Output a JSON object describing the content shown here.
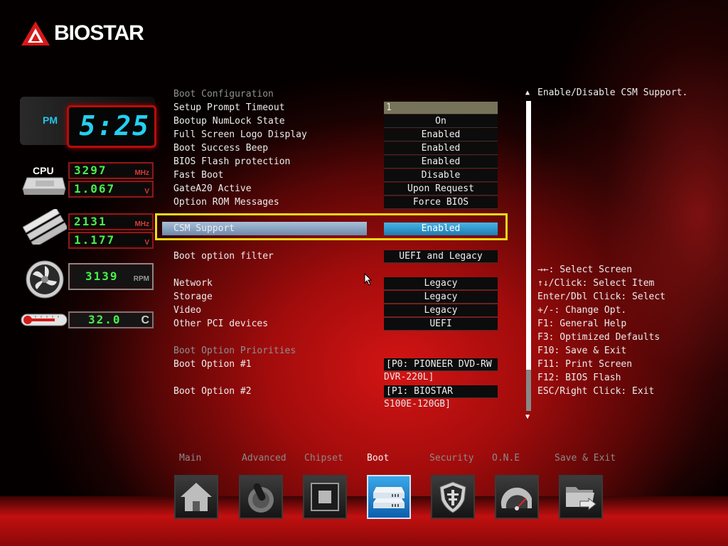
{
  "brand": {
    "name": "BIOSTAR"
  },
  "clock": {
    "ampm": "PM",
    "time": "5:25"
  },
  "sensors": {
    "cpu_label": "CPU",
    "cpu_freq": {
      "value": "3297",
      "unit": "MHz"
    },
    "cpu_volt": {
      "value": "1.067",
      "unit": "V"
    },
    "mem_freq": {
      "value": "2131",
      "unit": "MHz"
    },
    "mem_volt": {
      "value": "1.177",
      "unit": "V"
    },
    "fan": {
      "value": "3139",
      "unit": "RPM"
    },
    "temp": {
      "value": "32.0",
      "unit": "C"
    }
  },
  "options": {
    "boot_config_header": "Boot Configuration",
    "setup_prompt_timeout": {
      "label": "Setup Prompt Timeout",
      "value": "1"
    },
    "numlock": {
      "label": "Bootup NumLock State",
      "value": "On"
    },
    "logo": {
      "label": "Full Screen Logo Display",
      "value": "Enabled"
    },
    "beep": {
      "label": "Boot Success Beep",
      "value": "Enabled"
    },
    "flash_protect": {
      "label": "BIOS Flash protection",
      "value": "Enabled"
    },
    "fast_boot": {
      "label": "Fast Boot",
      "value": "Disable"
    },
    "gatea20": {
      "label": "GateA20 Active",
      "value": "Upon Request"
    },
    "option_rom": {
      "label": "Option ROM Messages",
      "value": "Force BIOS"
    },
    "csm": {
      "label": "CSM Support",
      "value": "Enabled"
    },
    "boot_filter": {
      "label": "Boot option filter",
      "value": "UEFI and Legacy"
    },
    "network": {
      "label": "Network",
      "value": "Legacy"
    },
    "storage": {
      "label": "Storage",
      "value": "Legacy"
    },
    "video": {
      "label": "Video",
      "value": "Legacy"
    },
    "other_pci": {
      "label": "Other PCI devices",
      "value": "UEFI"
    },
    "priorities_header": "Boot Option Priorities",
    "boot1": {
      "label": "Boot Option #1",
      "value_line1": "[P0: PIONEER DVD-RW",
      "value_line2": "DVR-220L]"
    },
    "boot2": {
      "label": "Boot Option #2",
      "value_line1": "[P1: BIOSTAR",
      "value_line2": "S100E-120GB]"
    }
  },
  "help": {
    "description": "Enable/Disable CSM Support.",
    "keys": [
      "→←: Select Screen",
      "↑↓/Click: Select Item",
      "Enter/Dbl Click: Select",
      "+/-: Change Opt.",
      "F1: General Help",
      "F3: Optimized Defaults",
      "F10: Save & Exit",
      "F11: Print Screen",
      "F12: BIOS Flash",
      "ESC/Right Click: Exit"
    ]
  },
  "tabs": [
    {
      "label": "Main",
      "icon": "home-icon"
    },
    {
      "label": "Advanced",
      "icon": "joystick-icon"
    },
    {
      "label": "Chipset",
      "icon": "chip-icon"
    },
    {
      "label": "Boot",
      "icon": "drive-icon",
      "active": true
    },
    {
      "label": "Security",
      "icon": "shield-icon"
    },
    {
      "label": "O.N.E",
      "icon": "gauge-icon"
    },
    {
      "label": "Save & Exit",
      "icon": "folder-exit-icon"
    }
  ],
  "colors": {
    "accent": "#f3d81a",
    "active_value": "#1e7bb0",
    "digit_green": "#48f04a",
    "digit_cyan": "#23d0f0"
  }
}
